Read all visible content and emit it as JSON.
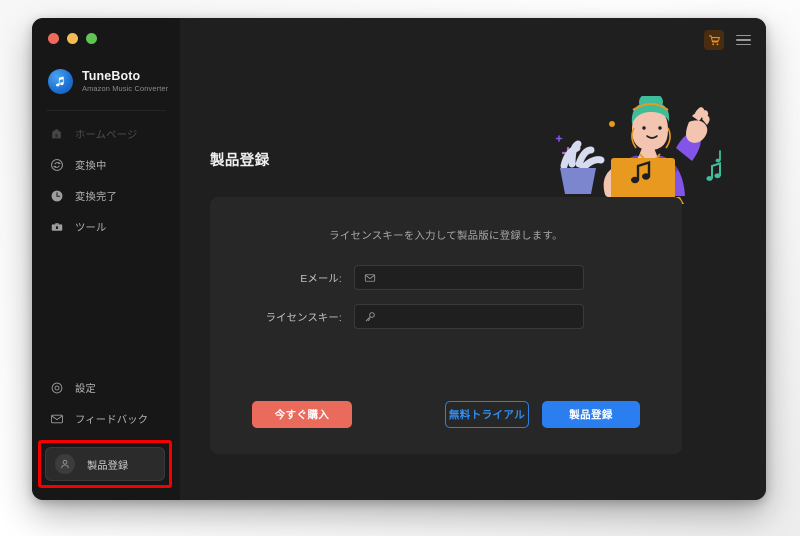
{
  "window": {
    "traffic_lights": [
      {
        "name": "close",
        "color": "#ee6a5f"
      },
      {
        "name": "minimize",
        "color": "#f5bd4f"
      },
      {
        "name": "maximize",
        "color": "#61c454"
      }
    ]
  },
  "brand": {
    "name": "TuneBoto",
    "tagline": "Amazon Music Converter",
    "logo_icon": "music-note-icon",
    "logo_color": "#1b6fd1"
  },
  "sidebar": {
    "items": [
      {
        "label": "ホームページ",
        "icon": "home-icon",
        "disabled": true
      },
      {
        "label": "変換中",
        "icon": "convert-refresh-icon",
        "disabled": false
      },
      {
        "label": "変換完了",
        "icon": "clock-history-icon",
        "disabled": false
      },
      {
        "label": "ツール",
        "icon": "toolbox-icon",
        "disabled": false
      }
    ],
    "bottom_items": [
      {
        "label": "設定",
        "icon": "gear-icon"
      },
      {
        "label": "フィードバック",
        "icon": "envelope-icon"
      }
    ],
    "highlighted_item": {
      "label": "製品登録",
      "icon": "person-avatar-icon",
      "highlight_color": "#f40000"
    }
  },
  "titlebar": {
    "cart_icon": "shopping-cart-icon",
    "cart_color": "#e8921f",
    "menu_icon": "hamburger-menu-icon"
  },
  "main": {
    "page_title": "製品登録",
    "card": {
      "subtitle": "ライセンスキーを入力して製品版に登録します。",
      "fields": [
        {
          "label": "Eメール:",
          "icon": "envelope-icon",
          "value": "",
          "placeholder": ""
        },
        {
          "label": "ライセンスキー:",
          "icon": "key-icon",
          "value": "",
          "placeholder": ""
        }
      ],
      "buttons": {
        "buy_now": "今すぐ購入",
        "free_trial": "無料トライアル",
        "register": "製品登録"
      },
      "colors": {
        "buy_now": "#ea6a5c",
        "free_trial_border": "#2f7fe0",
        "register": "#2b7ef0"
      }
    },
    "illustration": {
      "name": "person-with-laptop-illustration",
      "hair_color": "#3fbd9a",
      "shirt_color": "#8254e8",
      "laptop_color": "#e8991f",
      "skin_color": "#f3c5b0"
    }
  }
}
